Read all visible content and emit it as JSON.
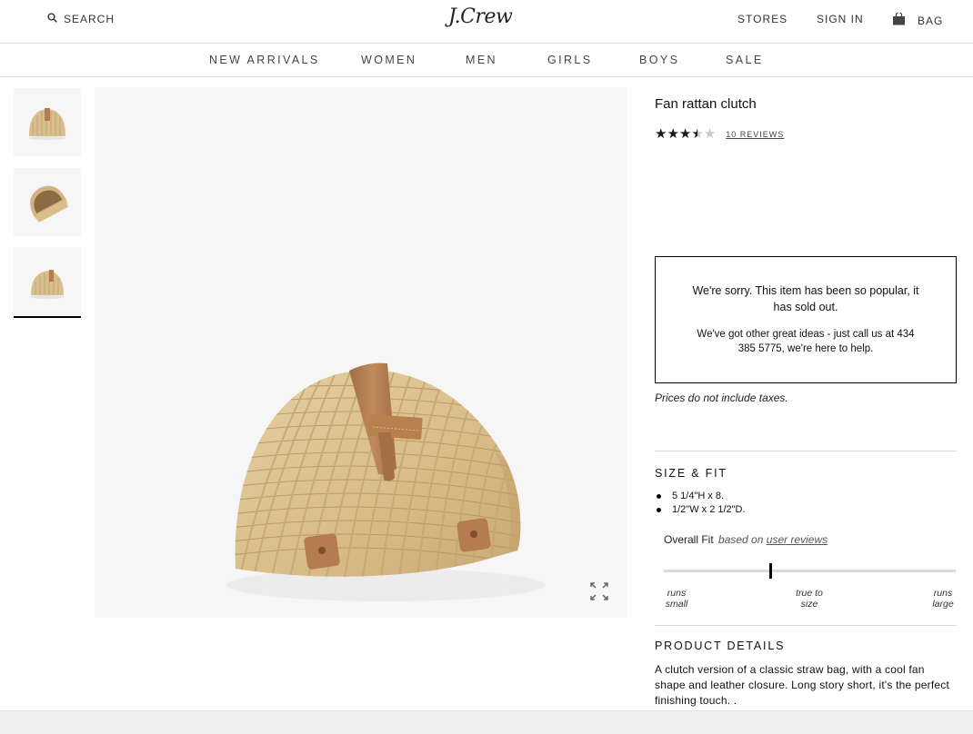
{
  "header": {
    "search_label": "SEARCH",
    "logo_text": "J.Crew",
    "stores_label": "STORES",
    "signin_label": "SIGN IN",
    "bag_label": "BAG"
  },
  "nav": {
    "items": [
      "NEW ARRIVALS",
      "WOMEN",
      "MEN",
      "GIRLS",
      "BOYS",
      "SALE"
    ]
  },
  "product": {
    "title": "Fan rattan clutch",
    "rating": 3.5,
    "rating_max": 5,
    "reviews_label": "10 REVIEWS",
    "soldout_line1": "We're sorry. This item has been so popular, it has sold out.",
    "soldout_line2": "We've got other great ideas - just call us at 434 385 5775, we're here to help.",
    "taxes_note": "Prices do not include taxes."
  },
  "size_fit": {
    "heading": "SIZE & FIT",
    "items": [
      "5 1/4\"H x 8.",
      "1/2\"W x 2 1/2\"D."
    ],
    "overall_label": "Overall Fit",
    "based_on": "based on",
    "user_reviews_link": "user reviews",
    "scale": {
      "left": [
        "runs",
        "small"
      ],
      "center": [
        "true to",
        "size"
      ],
      "right": [
        "runs",
        "large"
      ]
    },
    "fit_position": 0.36
  },
  "product_details": {
    "heading": "PRODUCT DETAILS",
    "text": "A clutch version of a classic straw bag, with a cool fan shape and leather closure. Long story short, it's the perfect finishing touch. ."
  },
  "icons": {
    "search": "search-icon",
    "bag": "bag-icon",
    "expand": "expand-icon"
  },
  "colors": {
    "rattan": "#d9bf8e",
    "leather": "#b57c52",
    "star": "#1a1a1a",
    "star_empty": "#c8c8c8"
  }
}
